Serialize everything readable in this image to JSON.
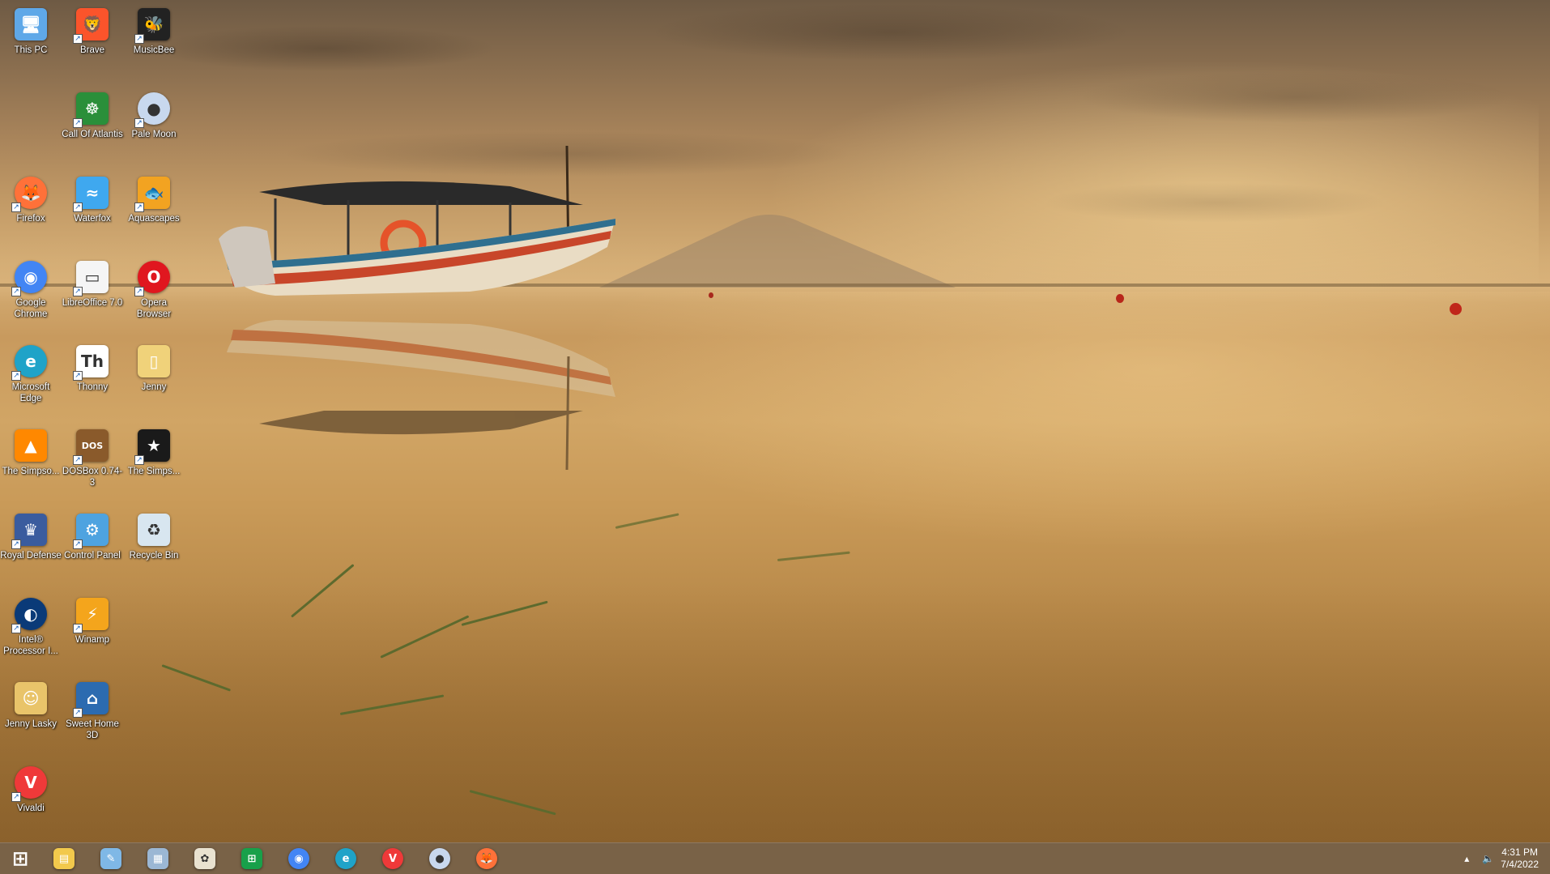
{
  "desktop": {
    "icons": [
      {
        "label": "This PC",
        "icon": "this-pc-icon",
        "color": "#5fa8e8",
        "shortcut": false
      },
      {
        "label": "Brave",
        "icon": "brave-icon",
        "color": "#fb542b",
        "shortcut": true
      },
      {
        "label": "MusicBee",
        "icon": "musicbee-icon",
        "color": "#222222",
        "shortcut": true
      },
      {
        "label": "Call Of Atlantis",
        "icon": "call-of-atlantis-icon",
        "color": "#2a8f3a",
        "shortcut": true
      },
      {
        "label": "Pale Moon",
        "icon": "pale-moon-icon",
        "color": "#c8d8ee",
        "shortcut": true
      },
      {
        "label": "Firefox",
        "icon": "firefox-icon",
        "color": "#ff7139",
        "shortcut": true
      },
      {
        "label": "Waterfox",
        "icon": "waterfox-icon",
        "color": "#3fa8ef",
        "shortcut": true
      },
      {
        "label": "Aquascapes",
        "icon": "aquascapes-icon",
        "color": "#f2a321",
        "shortcut": true
      },
      {
        "label": "Google Chrome",
        "icon": "chrome-icon",
        "color": "#4285f4",
        "shortcut": true
      },
      {
        "label": "LibreOffice 7.0",
        "icon": "libreoffice-icon",
        "color": "#f5f5f5",
        "shortcut": true
      },
      {
        "label": "Opera Browser",
        "icon": "opera-icon",
        "color": "#e0171f",
        "shortcut": true
      },
      {
        "label": "Microsoft Edge",
        "icon": "edge-icon",
        "color": "#1fa3c8",
        "shortcut": true
      },
      {
        "label": "Thonny",
        "icon": "thonny-icon",
        "color": "#ffffff",
        "shortcut": true
      },
      {
        "label": "Jenny",
        "icon": "folder-icon",
        "color": "#f0d27a",
        "shortcut": false
      },
      {
        "label": "The Simpso...",
        "icon": "vlc-icon",
        "color": "#ff8800",
        "shortcut": false
      },
      {
        "label": "DOSBox 0.74-3",
        "icon": "dosbox-icon",
        "color": "#8a5a2b",
        "shortcut": true
      },
      {
        "label": "The Simps...",
        "icon": "simpsons-game-icon",
        "color": "#1a1a1a",
        "shortcut": true
      },
      {
        "label": "Royal Defense",
        "icon": "royal-defense-icon",
        "color": "#3a5c9e",
        "shortcut": true
      },
      {
        "label": "Control Panel",
        "icon": "control-panel-icon",
        "color": "#4ea3e0",
        "shortcut": true
      },
      {
        "label": "Recycle Bin",
        "icon": "recycle-bin-icon",
        "color": "#d8e6f0",
        "shortcut": false
      },
      {
        "label": "Intel® Processor I...",
        "icon": "intel-processor-icon",
        "color": "#0a3a78",
        "shortcut": true
      },
      {
        "label": "Winamp",
        "icon": "winamp-icon",
        "color": "#f4a51c",
        "shortcut": true
      },
      {
        "label": "Jenny Lasky",
        "icon": "user-folder-icon",
        "color": "#e9c46a",
        "shortcut": false
      },
      {
        "label": "Sweet Home 3D",
        "icon": "sweet-home-3d-icon",
        "color": "#2c6bb0",
        "shortcut": true
      },
      {
        "label": "Vivaldi",
        "icon": "vivaldi-icon",
        "color": "#ef3939",
        "shortcut": true
      }
    ]
  },
  "taskbar": {
    "items": [
      {
        "icon": "windows-start-icon",
        "color": "#ffffff"
      },
      {
        "icon": "file-explorer-icon",
        "color": "#f2c94c"
      },
      {
        "icon": "notepad-icon",
        "color": "#7fb8e6"
      },
      {
        "icon": "calculator-icon",
        "color": "#9bb7d4"
      },
      {
        "icon": "paint-icon",
        "color": "#e9e2d0"
      },
      {
        "icon": "microsoft-store-icon",
        "color": "#18a04a"
      },
      {
        "icon": "chrome-icon",
        "color": "#4285f4"
      },
      {
        "icon": "edge-icon",
        "color": "#1fa3c8"
      },
      {
        "icon": "vivaldi-icon",
        "color": "#ef3939"
      },
      {
        "icon": "pale-moon-icon",
        "color": "#c8d8ee"
      },
      {
        "icon": "firefox-icon",
        "color": "#ff7139"
      }
    ],
    "tray": {
      "overflow_icon": "chevron-up-icon",
      "volume_icon": "speaker-icon",
      "time": "4:31 PM",
      "date": "7/4/2022"
    }
  }
}
